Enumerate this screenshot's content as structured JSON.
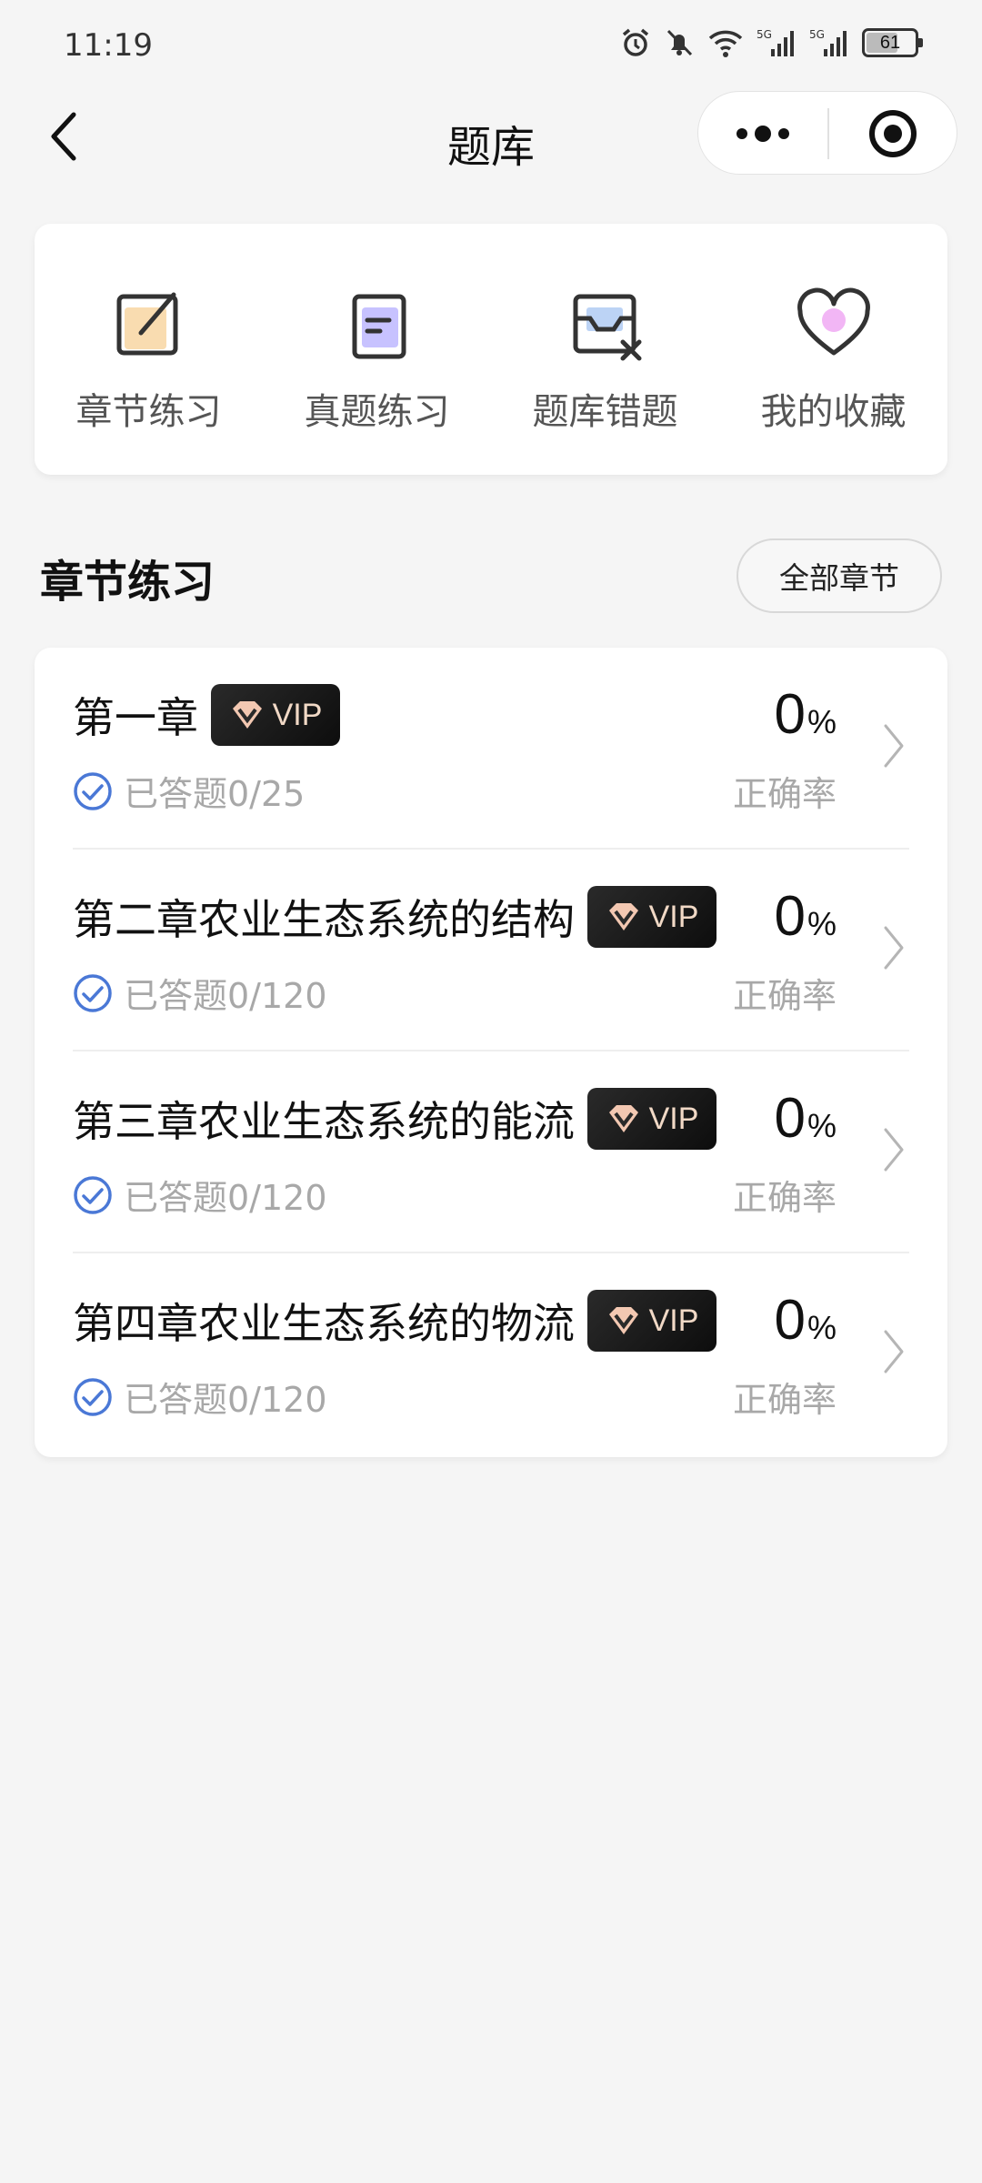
{
  "status_bar": {
    "time": "11:19",
    "battery": "61"
  },
  "nav": {
    "title": "题库"
  },
  "quick_actions": [
    {
      "label": "章节练习",
      "icon": "edit-note-icon"
    },
    {
      "label": "真题练习",
      "icon": "document-icon"
    },
    {
      "label": "题库错题",
      "icon": "wrong-tray-icon"
    },
    {
      "label": "我的收藏",
      "icon": "heart-icon"
    }
  ],
  "section": {
    "title": "章节练习",
    "all_button": "全部章节"
  },
  "chapters": [
    {
      "name": "第一章",
      "vip": "VIP",
      "answered": "已答题0/25",
      "rate": "0",
      "rate_unit": "%",
      "rate_label": "正确率"
    },
    {
      "name": "第二章农业生态系统的结构",
      "vip": "VIP",
      "answered": "已答题0/120",
      "rate": "0",
      "rate_unit": "%",
      "rate_label": "正确率"
    },
    {
      "name": "第三章农业生态系统的能流",
      "vip": "VIP",
      "answered": "已答题0/120",
      "rate": "0",
      "rate_unit": "%",
      "rate_label": "正确率"
    },
    {
      "name": "第四章农业生态系统的物流",
      "vip": "VIP",
      "answered": "已答题0/120",
      "rate": "0",
      "rate_unit": "%",
      "rate_label": "正确率"
    }
  ],
  "colors": {
    "accent_blue": "#4a78d6",
    "vip_bg": "#111111",
    "vip_text": "#f1d9c6"
  }
}
